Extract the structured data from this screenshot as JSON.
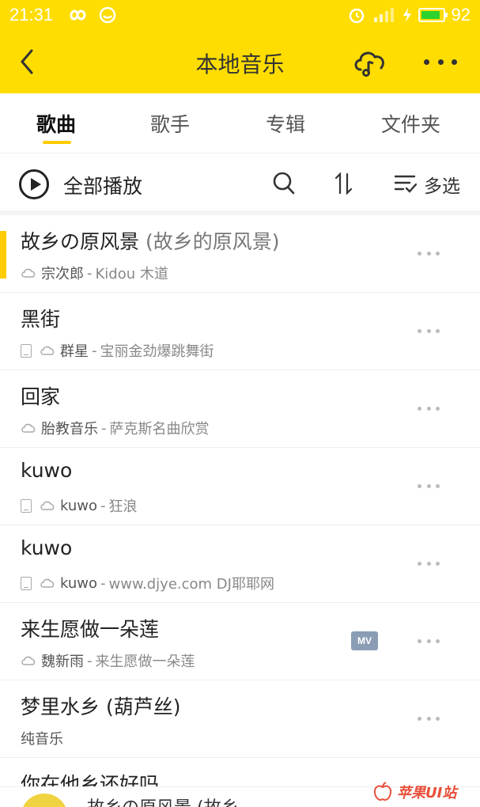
{
  "status_bar": {
    "time": "21:31",
    "battery": "92",
    "battery_level": 0.92
  },
  "header": {
    "title": "本地音乐"
  },
  "tabs": [
    {
      "label": "歌曲",
      "active": true
    },
    {
      "label": "歌手",
      "active": false
    },
    {
      "label": "专辑",
      "active": false
    },
    {
      "label": "文件夹",
      "active": false
    }
  ],
  "toolbar": {
    "play_all": "全部播放",
    "multi_select": "多选"
  },
  "songs": [
    {
      "title": "故乡の原风景",
      "alt_title": "(故乡的原风景)",
      "artist": "宗次郎",
      "album": "Kidou 木道",
      "local": false,
      "playing": true,
      "mv": false
    },
    {
      "title": "黑街",
      "alt_title": "",
      "artist": "群星",
      "album": "宝丽金劲爆跳舞街",
      "local": true,
      "playing": false,
      "mv": false
    },
    {
      "title": "回家",
      "alt_title": "",
      "artist": "胎教音乐",
      "album": "萨克斯名曲欣赏",
      "local": false,
      "playing": false,
      "mv": false
    },
    {
      "title": "kuwo",
      "alt_title": "",
      "artist": "kuwo",
      "album": "狂浪",
      "local": true,
      "playing": false,
      "mv": false
    },
    {
      "title": "kuwo",
      "alt_title": "",
      "artist": "kuwo",
      "album": "www.djye.com DJ耶耶网",
      "local": true,
      "playing": false,
      "mv": false
    },
    {
      "title": "来生愿做一朵莲",
      "alt_title": "",
      "artist": "魏新雨",
      "album": "来生愿做一朵莲",
      "local": false,
      "playing": false,
      "mv": true,
      "mv_label": "MV"
    },
    {
      "title": "梦里水乡 (葫芦丝)",
      "alt_title": "",
      "plain_sub": "纯音乐",
      "playing": false,
      "mv": false
    },
    {
      "title": "你在他乡还好吗",
      "alt_title": "",
      "playing": false,
      "mv": false
    }
  ],
  "player": {
    "now_playing": "故乡の原风景 (故乡"
  },
  "watermark": {
    "text": "苹果UI站"
  },
  "colors": {
    "accent": "#ffdd00",
    "indicator": "#ffcc00",
    "mv_badge": "#8a9db5"
  }
}
